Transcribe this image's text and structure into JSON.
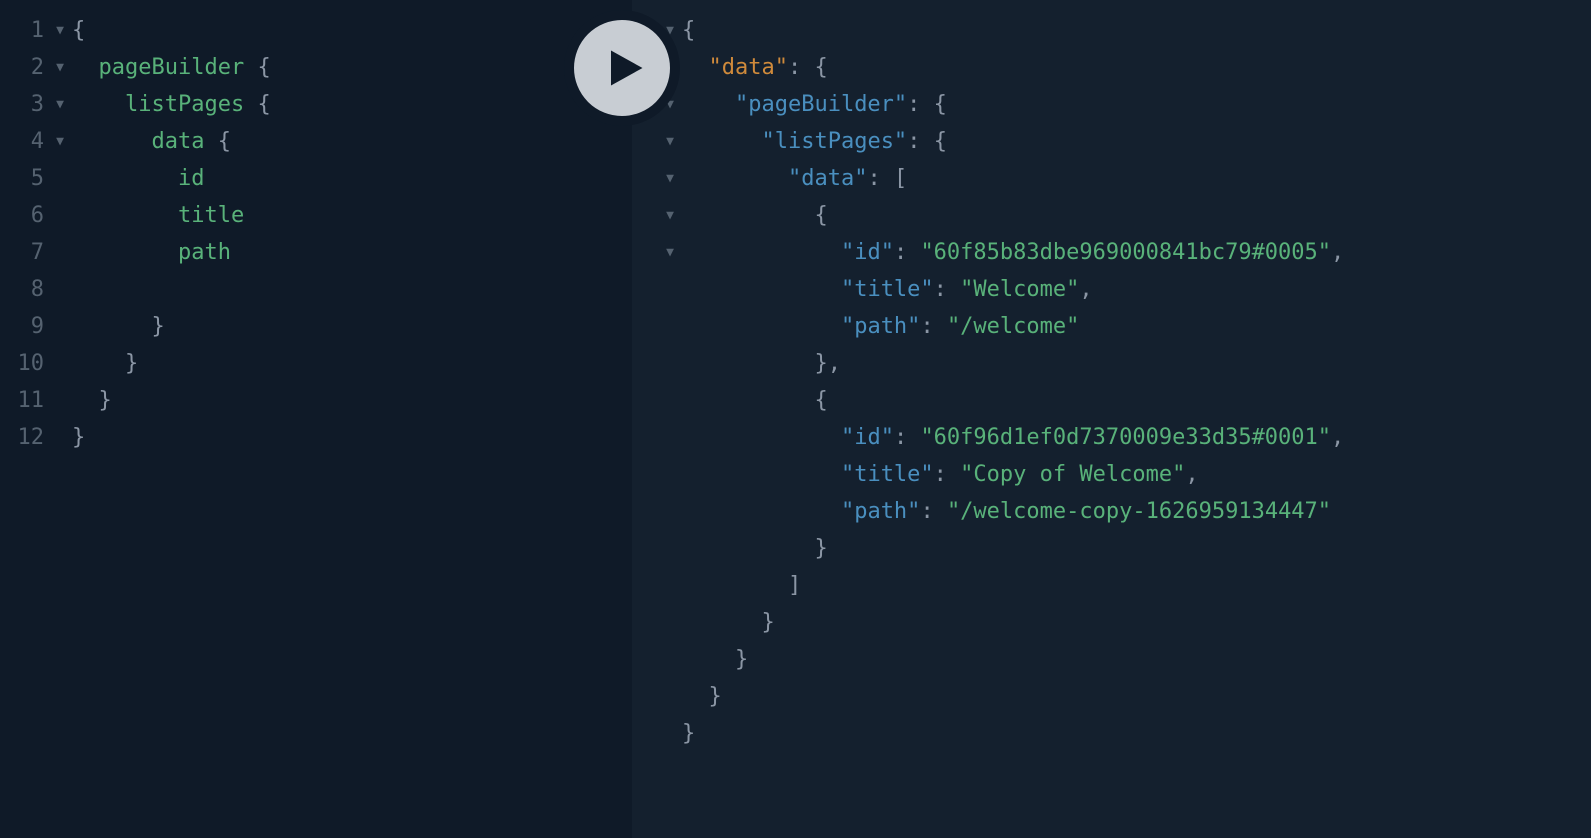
{
  "query": {
    "lines": [
      {
        "n": "1",
        "fold": true,
        "segs": [
          {
            "c": "tok-brace",
            "t": "{"
          }
        ]
      },
      {
        "n": "2",
        "fold": true,
        "segs": [
          {
            "c": "",
            "t": "  "
          },
          {
            "c": "tok-field",
            "t": "pageBuilder"
          },
          {
            "c": "tok-brace",
            "t": " {"
          }
        ]
      },
      {
        "n": "3",
        "fold": true,
        "segs": [
          {
            "c": "",
            "t": "    "
          },
          {
            "c": "tok-field",
            "t": "listPages"
          },
          {
            "c": "tok-brace",
            "t": " {"
          }
        ]
      },
      {
        "n": "4",
        "fold": true,
        "segs": [
          {
            "c": "",
            "t": "      "
          },
          {
            "c": "tok-field",
            "t": "data"
          },
          {
            "c": "tok-brace",
            "t": " {"
          }
        ]
      },
      {
        "n": "5",
        "fold": false,
        "segs": [
          {
            "c": "",
            "t": "        "
          },
          {
            "c": "tok-field",
            "t": "id"
          }
        ]
      },
      {
        "n": "6",
        "fold": false,
        "segs": [
          {
            "c": "",
            "t": "        "
          },
          {
            "c": "tok-field",
            "t": "title"
          }
        ]
      },
      {
        "n": "7",
        "fold": false,
        "segs": [
          {
            "c": "",
            "t": "        "
          },
          {
            "c": "tok-field",
            "t": "path"
          }
        ]
      },
      {
        "n": "8",
        "fold": false,
        "segs": [
          {
            "c": "",
            "t": ""
          }
        ]
      },
      {
        "n": "9",
        "fold": false,
        "segs": [
          {
            "c": "",
            "t": "      "
          },
          {
            "c": "tok-brace",
            "t": "}"
          }
        ]
      },
      {
        "n": "10",
        "fold": false,
        "segs": [
          {
            "c": "",
            "t": "    "
          },
          {
            "c": "tok-brace",
            "t": "}"
          }
        ]
      },
      {
        "n": "11",
        "fold": false,
        "segs": [
          {
            "c": "",
            "t": "  "
          },
          {
            "c": "tok-brace",
            "t": "}"
          }
        ]
      },
      {
        "n": "12",
        "fold": false,
        "segs": [
          {
            "c": "tok-brace",
            "t": "}"
          }
        ]
      }
    ]
  },
  "result": {
    "lines": [
      {
        "fold": true,
        "segs": [
          {
            "c": "tok-brace",
            "t": "{"
          }
        ]
      },
      {
        "fold": true,
        "segs": [
          {
            "c": "",
            "t": "  "
          },
          {
            "c": "tok-orange",
            "t": "\"data\""
          },
          {
            "c": "tok-punc",
            "t": ": "
          },
          {
            "c": "tok-brace",
            "t": "{"
          }
        ]
      },
      {
        "fold": true,
        "segs": [
          {
            "c": "",
            "t": "    "
          },
          {
            "c": "tok-key",
            "t": "\"pageBuilder\""
          },
          {
            "c": "tok-punc",
            "t": ": "
          },
          {
            "c": "tok-brace",
            "t": "{"
          }
        ]
      },
      {
        "fold": true,
        "segs": [
          {
            "c": "",
            "t": "      "
          },
          {
            "c": "tok-key",
            "t": "\"listPages\""
          },
          {
            "c": "tok-punc",
            "t": ": "
          },
          {
            "c": "tok-brace",
            "t": "{"
          }
        ]
      },
      {
        "fold": true,
        "segs": [
          {
            "c": "",
            "t": "        "
          },
          {
            "c": "tok-key",
            "t": "\"data\""
          },
          {
            "c": "tok-punc",
            "t": ": "
          },
          {
            "c": "tok-brace",
            "t": "["
          }
        ]
      },
      {
        "fold": true,
        "segs": [
          {
            "c": "",
            "t": "          "
          },
          {
            "c": "tok-brace",
            "t": "{"
          }
        ]
      },
      {
        "fold": false,
        "segs": [
          {
            "c": "",
            "t": "            "
          },
          {
            "c": "tok-key",
            "t": "\"id\""
          },
          {
            "c": "tok-punc",
            "t": ": "
          },
          {
            "c": "tok-str",
            "t": "\"60f85b83dbe969000841bc79#0005\""
          },
          {
            "c": "tok-punc",
            "t": ","
          }
        ]
      },
      {
        "fold": false,
        "segs": [
          {
            "c": "",
            "t": "            "
          },
          {
            "c": "tok-key",
            "t": "\"title\""
          },
          {
            "c": "tok-punc",
            "t": ": "
          },
          {
            "c": "tok-str",
            "t": "\"Welcome\""
          },
          {
            "c": "tok-punc",
            "t": ","
          }
        ]
      },
      {
        "fold": false,
        "segs": [
          {
            "c": "",
            "t": "            "
          },
          {
            "c": "tok-key",
            "t": "\"path\""
          },
          {
            "c": "tok-punc",
            "t": ": "
          },
          {
            "c": "tok-str",
            "t": "\"/welcome\""
          }
        ]
      },
      {
        "fold": false,
        "segs": [
          {
            "c": "",
            "t": "          "
          },
          {
            "c": "tok-brace",
            "t": "},"
          }
        ]
      },
      {
        "fold": true,
        "segs": [
          {
            "c": "",
            "t": "          "
          },
          {
            "c": "tok-brace",
            "t": "{"
          }
        ]
      },
      {
        "fold": false,
        "segs": [
          {
            "c": "",
            "t": "            "
          },
          {
            "c": "tok-key",
            "t": "\"id\""
          },
          {
            "c": "tok-punc",
            "t": ": "
          },
          {
            "c": "tok-str",
            "t": "\"60f96d1ef0d7370009e33d35#0001\""
          },
          {
            "c": "tok-punc",
            "t": ","
          }
        ]
      },
      {
        "fold": false,
        "segs": [
          {
            "c": "",
            "t": "            "
          },
          {
            "c": "tok-key",
            "t": "\"title\""
          },
          {
            "c": "tok-punc",
            "t": ": "
          },
          {
            "c": "tok-str",
            "t": "\"Copy of Welcome\""
          },
          {
            "c": "tok-punc",
            "t": ","
          }
        ]
      },
      {
        "fold": false,
        "segs": [
          {
            "c": "",
            "t": "            "
          },
          {
            "c": "tok-key",
            "t": "\"path\""
          },
          {
            "c": "tok-punc",
            "t": ": "
          },
          {
            "c": "tok-str",
            "t": "\"/welcome-copy-1626959134447\""
          }
        ]
      },
      {
        "fold": false,
        "segs": [
          {
            "c": "",
            "t": "          "
          },
          {
            "c": "tok-brace",
            "t": "}"
          }
        ]
      },
      {
        "fold": false,
        "segs": [
          {
            "c": "",
            "t": "        "
          },
          {
            "c": "tok-brace",
            "t": "]"
          }
        ]
      },
      {
        "fold": false,
        "segs": [
          {
            "c": "",
            "t": "      "
          },
          {
            "c": "tok-brace",
            "t": "}"
          }
        ]
      },
      {
        "fold": false,
        "segs": [
          {
            "c": "",
            "t": "    "
          },
          {
            "c": "tok-brace",
            "t": "}"
          }
        ]
      },
      {
        "fold": false,
        "segs": [
          {
            "c": "",
            "t": "  "
          },
          {
            "c": "tok-brace",
            "t": "}"
          }
        ]
      },
      {
        "fold": false,
        "segs": [
          {
            "c": "tok-brace",
            "t": "}"
          }
        ]
      }
    ]
  }
}
